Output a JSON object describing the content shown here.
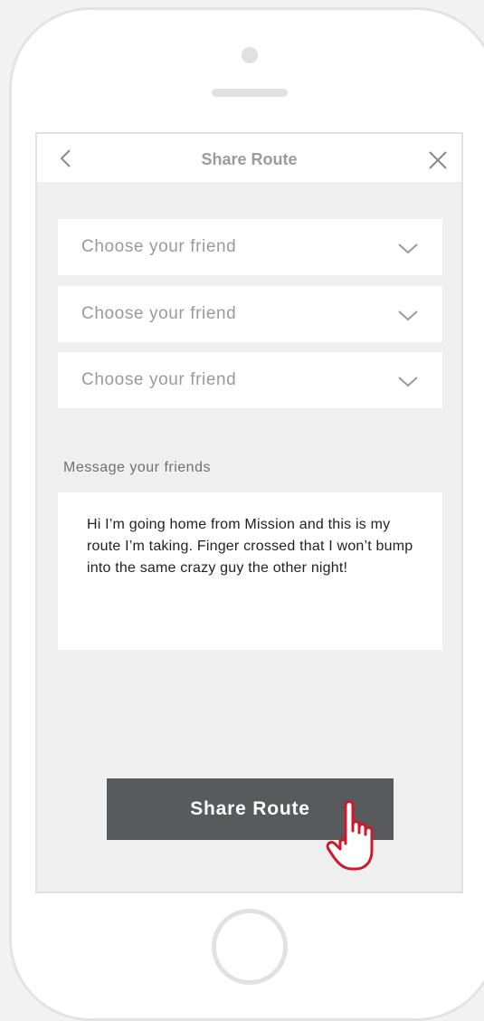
{
  "header": {
    "title": "Share Route",
    "back_icon": "chevron-left-icon",
    "close_icon": "close-icon"
  },
  "friend_selects": [
    {
      "placeholder": "Choose your friend"
    },
    {
      "placeholder": "Choose your friend"
    },
    {
      "placeholder": "Choose your friend"
    }
  ],
  "message": {
    "label": "Message your friends",
    "text": "Hi I’m going home from Mission and this is my route I’m taking. Finger crossed that I won’t bump into the same crazy guy the other night!"
  },
  "share_button": {
    "label": "Share Route"
  },
  "colors": {
    "button_bg": "#595a5c",
    "screen_bg": "#efefef",
    "cursor_accent": "#d0182a"
  }
}
